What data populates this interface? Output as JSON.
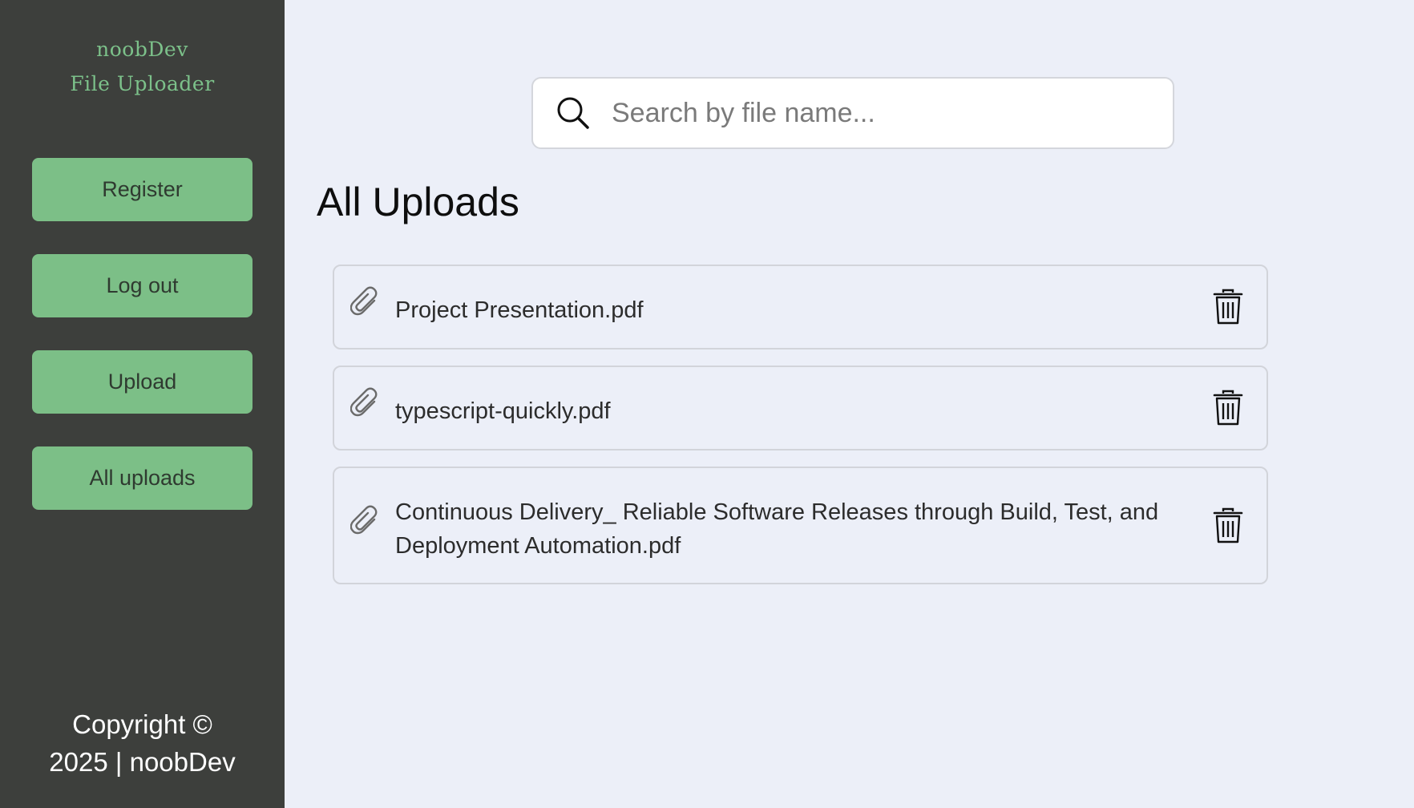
{
  "sidebar": {
    "brand": {
      "line1": "noobDev",
      "line2": "File Uploader"
    },
    "nav": [
      {
        "label": "Register"
      },
      {
        "label": "Log out"
      },
      {
        "label": "Upload"
      },
      {
        "label": "All uploads"
      }
    ],
    "copyright": {
      "line1": "Copyright ©",
      "line2": "2025 | noobDev"
    }
  },
  "main": {
    "search": {
      "placeholder": "Search by file name...",
      "value": "",
      "icon": "search-icon"
    },
    "title": "All Uploads",
    "files": [
      {
        "name": "Project Presentation.pdf",
        "icon": "paperclip-icon",
        "action_icon": "trash-icon"
      },
      {
        "name": "typescript-quickly.pdf",
        "icon": "paperclip-icon",
        "action_icon": "trash-icon"
      },
      {
        "name": "Continuous Delivery_ Reliable Software Releases through Build, Test, and Deployment Automation.pdf",
        "icon": "paperclip-icon",
        "action_icon": "trash-icon"
      }
    ]
  },
  "colors": {
    "sidebar_bg": "#3d3f3c",
    "brand_text": "#7cc18a",
    "nav_button_bg": "#7cbf87",
    "main_bg": "#eceff8",
    "row_border": "#d2d4da"
  }
}
